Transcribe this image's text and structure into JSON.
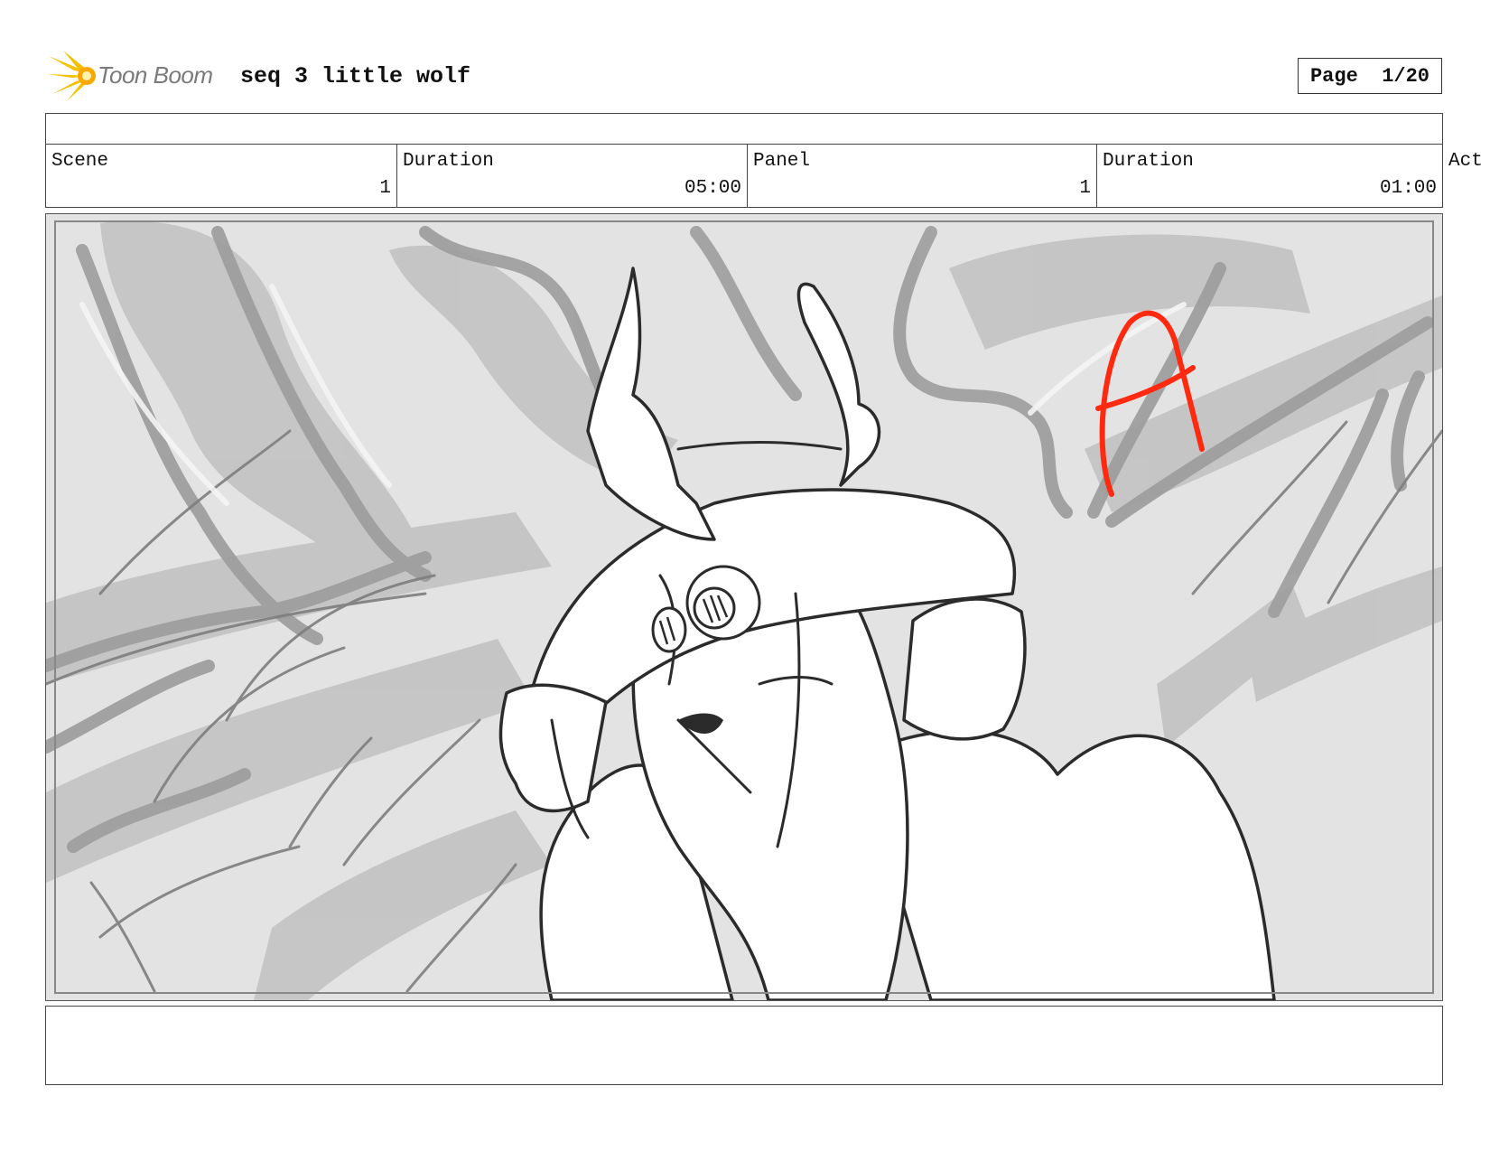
{
  "header": {
    "logo_text": "Toon Boom",
    "project_title": "seq 3 little wolf",
    "page_label": "Page  1/20"
  },
  "info": {
    "scene_label": "Scene",
    "scene_value": "1",
    "scene_duration_label": "Duration",
    "scene_duration_value": "05:00",
    "panel_label": "Panel",
    "panel_value": "1",
    "panel_duration_label": "Duration",
    "panel_duration_value": "01:00",
    "action_label": "Act"
  },
  "colors": {
    "logo_accent": "#f6c000",
    "annotation_red": "#ff2a10",
    "sketch_gray": "#9a9a9a"
  },
  "panel_annotation": "A"
}
